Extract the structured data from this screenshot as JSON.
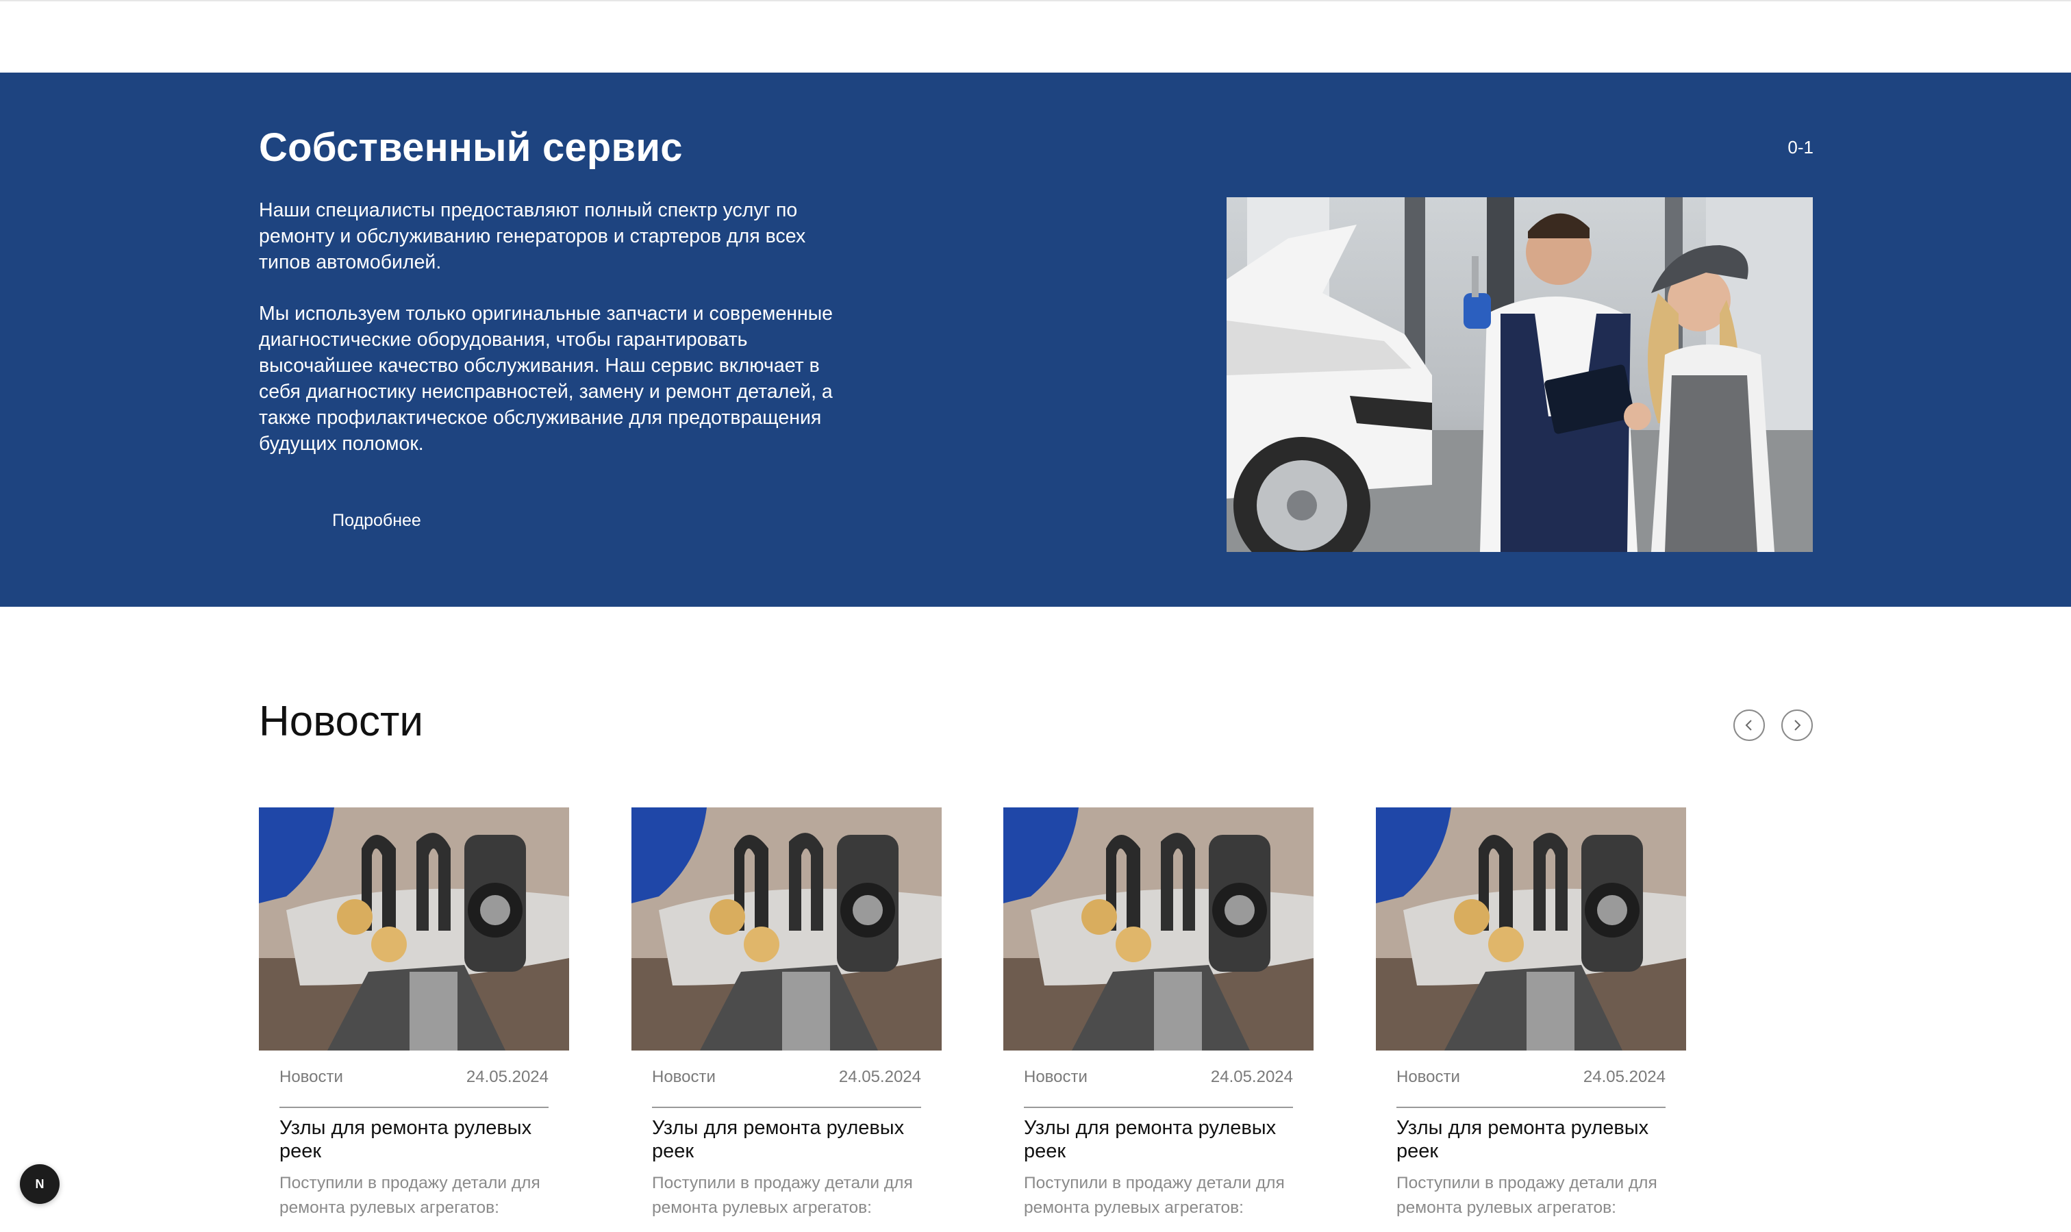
{
  "service": {
    "title": "Собственный сервис",
    "counter": "0-1",
    "paragraph_1": "Наши специалисты предоставляют полный спектр услуг по ремонту и обслуживанию генераторов и стартеров для всех типов автомобилей.",
    "paragraph_2": "Мы используем только оригинальные запчасти и современные диагностические оборудования, чтобы гарантировать высочайшее качество обслуживания. Наш сервис включает в себя диагностику неисправностей, замену и ремонт деталей, а также профилактическое обслуживание для предотвращения будущих поломок.",
    "more_label": "Подробнее",
    "colors": {
      "background": "#1e4480",
      "text": "#ffffff"
    }
  },
  "news": {
    "title": "Новости",
    "prev_icon": "chevron-left-icon",
    "next_icon": "chevron-right-icon",
    "cards": [
      {
        "category": "Новости",
        "date": "24.05.2024",
        "title": "Узлы для ремонта рулевых реек",
        "desc": "Поступили в продажу детали для ремонта рулевых агрегатов:"
      },
      {
        "category": "Новости",
        "date": "24.05.2024",
        "title": "Узлы для ремонта рулевых реек",
        "desc": "Поступили в продажу детали для ремонта рулевых агрегатов:"
      },
      {
        "category": "Новости",
        "date": "24.05.2024",
        "title": "Узлы для ремонта рулевых реек",
        "desc": "Поступили в продажу детали для ремонта рулевых агрегатов:"
      },
      {
        "category": "Новости",
        "date": "24.05.2024",
        "title": "Узлы для ремонта рулевых реек",
        "desc": "Поступили в продажу детали для ремонта рулевых агрегатов:"
      }
    ]
  },
  "badge": {
    "letter": "N"
  }
}
